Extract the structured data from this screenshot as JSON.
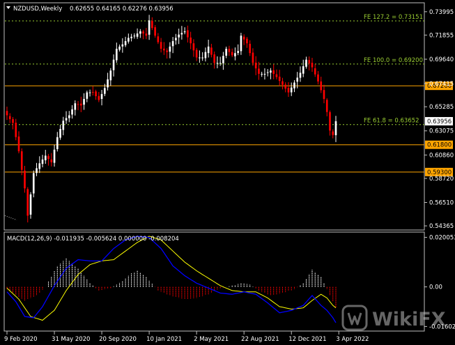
{
  "header": {
    "title": "NZDUSD,Weekly",
    "ohlc": "0.62655 0.64165 0.62276 0.63956"
  },
  "macd_header": "MACD(12,26,9) -0.011935 -0.005624 0.000000 -0.008204",
  "watermark": {
    "text": "WikiFX"
  },
  "colors": {
    "background": "#000000",
    "frame": "#c0c0c0",
    "bull": "#ffffff",
    "bear": "#ff0000",
    "level": "#ffa500",
    "fib": "#9acd32",
    "macd_bar_pos": "#ffffff",
    "macd_bar_neg": "#ff0000",
    "macd_line": "#0000ff",
    "signal_line": "#ffff00"
  },
  "chart_data": [
    {
      "type": "candlestick",
      "symbol": "NZDUSD",
      "timeframe": "Weekly",
      "ylim": [
        0.5405,
        0.7475
      ],
      "yticks": [
        "0.73995",
        "0.71855",
        "0.69640",
        "0.67415",
        "0.65285",
        "0.63075",
        "0.60860",
        "0.58720",
        "0.56510",
        "0.54365"
      ],
      "xticks": [
        "9 Feb 2020",
        "31 May 2020",
        "20 Sep 2020",
        "10 Jan 2021",
        "2 May 2021",
        "22 Aug 2021",
        "12 Dec 2021",
        "3 Apr 2022"
      ],
      "xtick_index": [
        0,
        16,
        32,
        48,
        64,
        80,
        96,
        112
      ],
      "anchors": [
        [
          0,
          0.645
        ],
        [
          2,
          0.638
        ],
        [
          4,
          0.612
        ],
        [
          6,
          0.578
        ],
        [
          7,
          0.553
        ],
        [
          9,
          0.592
        ],
        [
          11,
          0.601
        ],
        [
          13,
          0.608
        ],
        [
          15,
          0.602
        ],
        [
          17,
          0.625
        ],
        [
          19,
          0.64
        ],
        [
          21,
          0.645
        ],
        [
          23,
          0.656
        ],
        [
          25,
          0.654
        ],
        [
          27,
          0.666
        ],
        [
          29,
          0.666
        ],
        [
          31,
          0.659
        ],
        [
          33,
          0.67
        ],
        [
          35,
          0.686
        ],
        [
          37,
          0.706
        ],
        [
          39,
          0.71
        ],
        [
          41,
          0.716
        ],
        [
          43,
          0.718
        ],
        [
          45,
          0.722
        ],
        [
          47,
          0.718
        ],
        [
          48,
          0.732
        ],
        [
          50,
          0.718
        ],
        [
          52,
          0.706
        ],
        [
          54,
          0.703
        ],
        [
          56,
          0.713
        ],
        [
          58,
          0.719
        ],
        [
          60,
          0.722
        ],
        [
          62,
          0.711
        ],
        [
          64,
          0.698
        ],
        [
          66,
          0.698
        ],
        [
          68,
          0.708
        ],
        [
          70,
          0.693
        ],
        [
          72,
          0.693
        ],
        [
          74,
          0.706
        ],
        [
          76,
          0.7
        ],
        [
          78,
          0.704
        ],
        [
          79,
          0.718
        ],
        [
          81,
          0.711
        ],
        [
          83,
          0.693
        ],
        [
          85,
          0.683
        ],
        [
          87,
          0.683
        ],
        [
          89,
          0.686
        ],
        [
          91,
          0.68
        ],
        [
          93,
          0.673
        ],
        [
          95,
          0.666
        ],
        [
          97,
          0.675
        ],
        [
          99,
          0.684
        ],
        [
          101,
          0.696
        ],
        [
          103,
          0.689
        ],
        [
          105,
          0.676
        ],
        [
          107,
          0.66
        ],
        [
          108,
          0.648
        ],
        [
          109,
          0.631
        ],
        [
          110,
          0.6269
        ],
        [
          111,
          0.6396
        ]
      ],
      "bars": 112,
      "current_price": "0.63956",
      "levels": [
        {
          "price": 0.672,
          "label": "0.67200",
          "style": "solid"
        },
        {
          "price": 0.618,
          "label": "0.61800",
          "style": "solid"
        },
        {
          "price": 0.593,
          "label": "0.59300",
          "style": "solid"
        }
      ],
      "fib_levels": [
        {
          "price": 0.73151,
          "label": "FE 127.2 = 0.73151"
        },
        {
          "price": 0.692,
          "label": "FE 100.0 = 0.69200"
        },
        {
          "price": 0.63652,
          "label": "FE 61.8 = 0.63652"
        }
      ]
    },
    {
      "type": "macd",
      "params": "12,26,9",
      "ylim": [
        -0.0176,
        0.0216
      ],
      "yticks": [
        "0.020053",
        "0.00",
        "-0.016028"
      ],
      "histogram_anchors": [
        [
          0,
          -0.001
        ],
        [
          6,
          -0.0055
        ],
        [
          10,
          -0.0035
        ],
        [
          13,
          0.0
        ],
        [
          17,
          0.0085
        ],
        [
          20,
          0.0115
        ],
        [
          24,
          0.0075
        ],
        [
          28,
          0.0015
        ],
        [
          31,
          -0.0015
        ],
        [
          35,
          -0.0005
        ],
        [
          39,
          0.0025
        ],
        [
          42,
          0.0055
        ],
        [
          44,
          0.0065
        ],
        [
          47,
          0.004
        ],
        [
          51,
          -0.0015
        ],
        [
          55,
          -0.0035
        ],
        [
          60,
          -0.005
        ],
        [
          64,
          -0.0045
        ],
        [
          68,
          -0.003
        ],
        [
          72,
          -0.0005
        ],
        [
          76,
          0.0005
        ],
        [
          79,
          0.0015
        ],
        [
          82,
          0.001
        ],
        [
          85,
          -0.0015
        ],
        [
          89,
          -0.0035
        ],
        [
          93,
          -0.0025
        ],
        [
          97,
          -0.001
        ],
        [
          100,
          0.0015
        ],
        [
          103,
          0.007
        ],
        [
          106,
          0.004
        ],
        [
          108,
          -0.001
        ],
        [
          110,
          -0.006
        ],
        [
          111,
          -0.0082
        ]
      ],
      "macd_line_anchors": [
        [
          0,
          -0.002
        ],
        [
          3,
          -0.006
        ],
        [
          6,
          -0.012
        ],
        [
          9,
          -0.0125
        ],
        [
          12,
          -0.008
        ],
        [
          16,
          0.0005
        ],
        [
          20,
          0.0075
        ],
        [
          24,
          0.011
        ],
        [
          28,
          0.0105
        ],
        [
          32,
          0.0105
        ],
        [
          36,
          0.0155
        ],
        [
          40,
          0.019
        ],
        [
          44,
          0.0205
        ],
        [
          48,
          0.02
        ],
        [
          52,
          0.0155
        ],
        [
          56,
          0.0085
        ],
        [
          60,
          0.0045
        ],
        [
          64,
          0.0015
        ],
        [
          68,
          -0.0005
        ],
        [
          72,
          -0.0025
        ],
        [
          76,
          -0.003
        ],
        [
          80,
          -0.002
        ],
        [
          84,
          -0.003
        ],
        [
          88,
          -0.0065
        ],
        [
          92,
          -0.0105
        ],
        [
          96,
          -0.0095
        ],
        [
          100,
          -0.0075
        ],
        [
          103,
          -0.0035
        ],
        [
          106,
          -0.0075
        ],
        [
          108,
          -0.0095
        ],
        [
          110,
          -0.0125
        ],
        [
          111,
          -0.0145
        ]
      ],
      "signal_line_anchors": [
        [
          0,
          -0.0005
        ],
        [
          4,
          -0.005
        ],
        [
          8,
          -0.012
        ],
        [
          12,
          -0.0135
        ],
        [
          16,
          -0.0095
        ],
        [
          20,
          -0.0015
        ],
        [
          24,
          0.005
        ],
        [
          28,
          0.009
        ],
        [
          32,
          0.0105
        ],
        [
          36,
          0.011
        ],
        [
          40,
          0.0145
        ],
        [
          44,
          0.018
        ],
        [
          48,
          0.0205
        ],
        [
          52,
          0.019
        ],
        [
          56,
          0.0145
        ],
        [
          60,
          0.01
        ],
        [
          64,
          0.0065
        ],
        [
          68,
          0.0035
        ],
        [
          72,
          0.0005
        ],
        [
          76,
          -0.0015
        ],
        [
          80,
          -0.002
        ],
        [
          84,
          -0.002
        ],
        [
          88,
          -0.0045
        ],
        [
          92,
          -0.008
        ],
        [
          96,
          -0.009
        ],
        [
          100,
          -0.0085
        ],
        [
          103,
          -0.0055
        ],
        [
          106,
          -0.003
        ],
        [
          108,
          -0.0045
        ],
        [
          110,
          -0.0075
        ],
        [
          111,
          -0.0085
        ]
      ]
    }
  ]
}
